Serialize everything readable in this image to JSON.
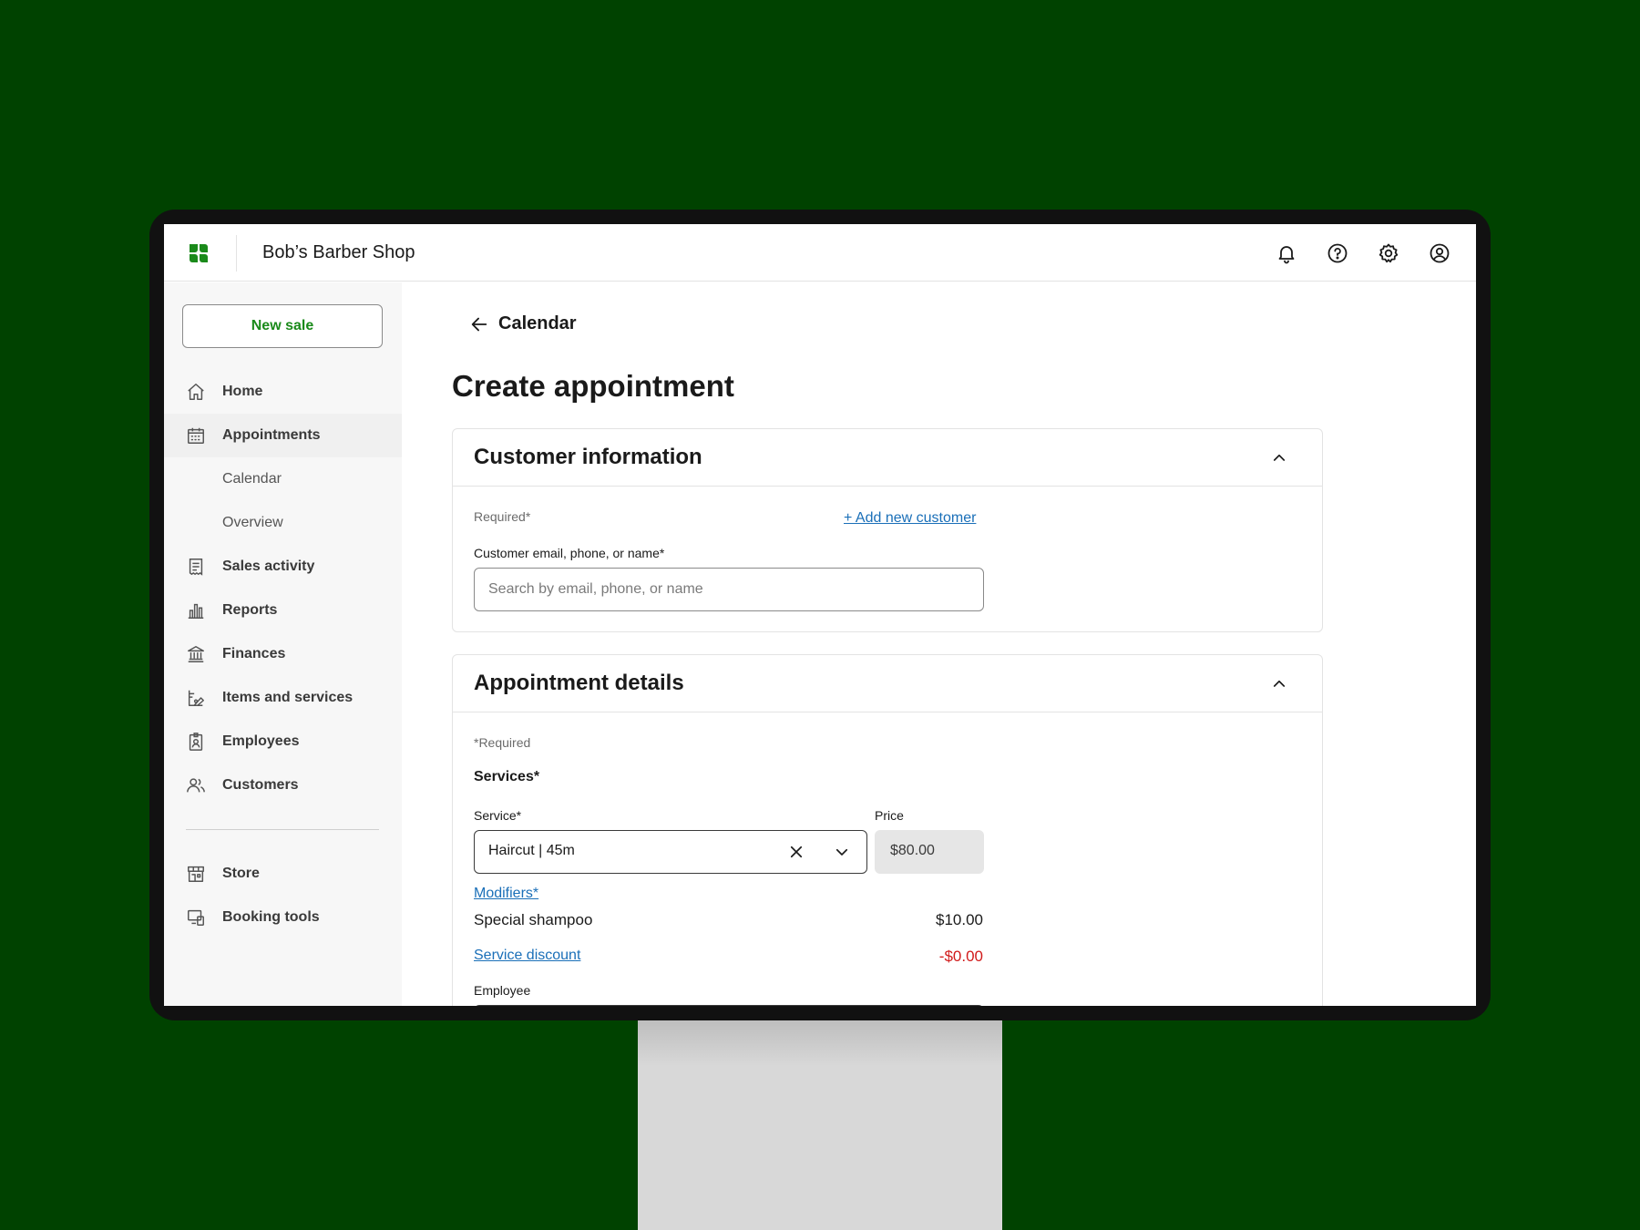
{
  "header": {
    "shop_name": "Bob’s Barber Shop",
    "icons": [
      "bell-icon",
      "help-icon",
      "gear-icon",
      "account-icon"
    ]
  },
  "sidebar": {
    "new_sale_label": "New sale",
    "items": [
      {
        "label": "Home",
        "icon": "home-icon"
      },
      {
        "label": "Appointments",
        "icon": "calendar-icon"
      },
      {
        "label": "Calendar"
      },
      {
        "label": "Overview"
      },
      {
        "label": "Sales activity",
        "icon": "receipt-icon"
      },
      {
        "label": "Reports",
        "icon": "bar-chart-icon"
      },
      {
        "label": "Finances",
        "icon": "bank-icon"
      },
      {
        "label": "Items and services",
        "icon": "items-icon"
      },
      {
        "label": "Employees",
        "icon": "badge-icon"
      },
      {
        "label": "Customers",
        "icon": "people-icon"
      },
      {
        "label": "Store",
        "icon": "store-icon"
      },
      {
        "label": "Booking tools",
        "icon": "devices-icon"
      }
    ]
  },
  "main": {
    "back_label": "Calendar",
    "page_title": "Create appointment",
    "customer_card": {
      "title": "Customer information",
      "required_note": "Required*",
      "add_customer_link": "+ Add new customer",
      "field_label": "Customer email, phone, or name*",
      "field_placeholder": "Search by email, phone, or name",
      "field_value": ""
    },
    "appointment_card": {
      "title": "Appointment details",
      "required_note": "*Required",
      "services_heading": "Services*",
      "service_label": "Service*",
      "service_value": "Haircut | 45m",
      "price_label": "Price",
      "price_value": "$80.00",
      "modifiers_link": "Modifiers*",
      "modifier_name": "Special shampoo",
      "modifier_price": "$10.00",
      "discount_link": "Service discount",
      "discount_value": "-$0.00",
      "employee_label": "Employee"
    }
  },
  "colors": {
    "background": "#004200",
    "brand_green": "#1a8a1a",
    "link_blue": "#1a6fb8",
    "discount_red": "#d11a1a"
  }
}
